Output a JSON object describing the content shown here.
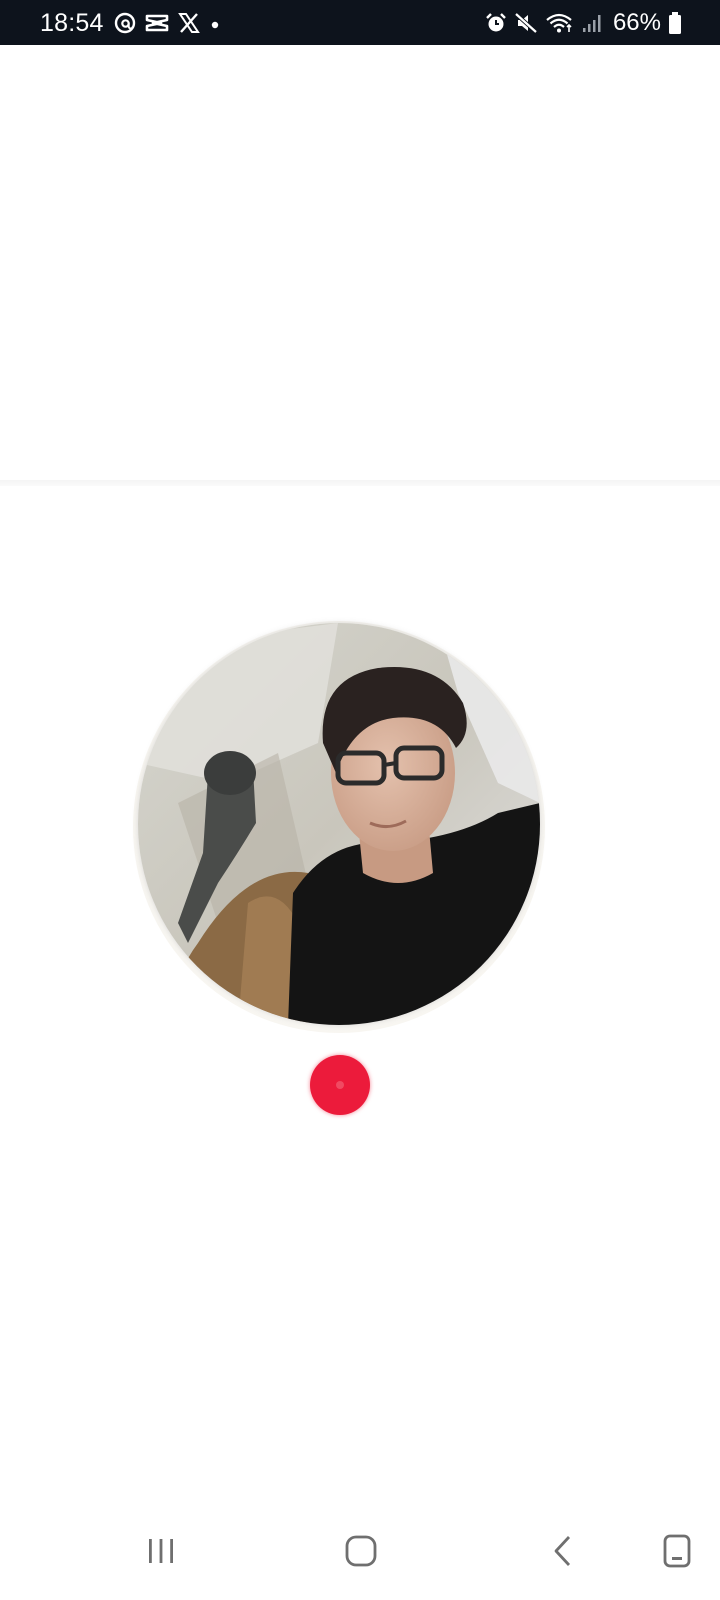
{
  "status_bar": {
    "time": "18:54",
    "left_icons": [
      "threads-icon",
      "capcut-icon",
      "x-icon",
      "dot-icon"
    ],
    "right_icons": [
      "alarm-icon",
      "mute-icon",
      "wifi-icon",
      "signal-icon",
      "battery-icon"
    ],
    "battery_percent": "66%"
  },
  "content": {
    "avatar": "profile-photo",
    "live_indicator_color": "#ec1b3b"
  },
  "nav_bar": {
    "buttons": [
      "recents-icon",
      "home-icon",
      "back-icon",
      "screenshot-icon"
    ]
  },
  "colors": {
    "status_bar_bg": "#0d131c",
    "accent_red": "#ec1b3b",
    "background": "#ffffff"
  }
}
